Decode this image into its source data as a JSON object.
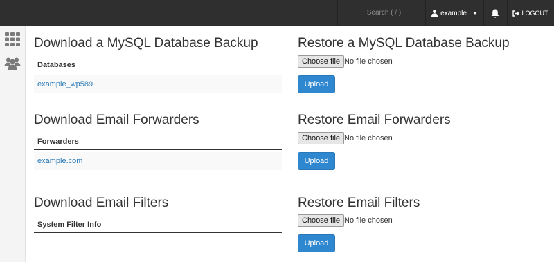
{
  "header": {
    "search_placeholder": "Search ( / )",
    "username": "example",
    "logout_label": "LOGOUT"
  },
  "sections": {
    "mysql": {
      "download_title": "Download a MySQL Database Backup",
      "column_header": "Databases",
      "items": [
        "example_wp589"
      ],
      "restore_title": "Restore a MySQL Database Backup"
    },
    "forwarders": {
      "download_title": "Download Email Forwarders",
      "column_header": "Forwarders",
      "items": [
        "example.com"
      ],
      "restore_title": "Restore Email Forwarders"
    },
    "filters": {
      "download_title": "Download Email Filters",
      "column_header": "System Filter Info",
      "restore_title": "Restore Email Filters"
    }
  },
  "file_input": {
    "button_label": "Choose file",
    "status": "No file chosen"
  },
  "upload_label": "Upload",
  "colors": {
    "topbar": "#2f2f2f",
    "link": "#2a7ab8",
    "primary_button": "#2f87cf",
    "rail_icon": "#7a7a7a"
  },
  "icons": [
    "apps-grid-icon",
    "users-group-icon",
    "user-icon",
    "bell-icon",
    "logout-icon"
  ]
}
